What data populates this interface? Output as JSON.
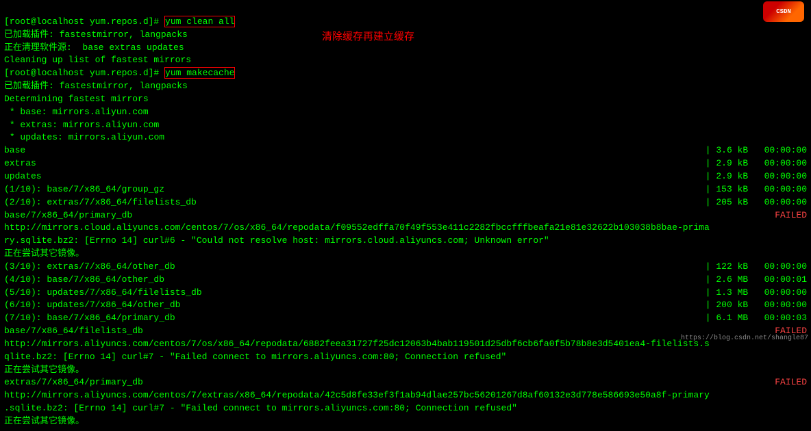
{
  "terminal": {
    "lines": [
      {
        "type": "cmd",
        "prompt": "[root@localhost yum.repos.d]# ",
        "cmd": "yum clean all",
        "highlight": true
      },
      {
        "type": "normal",
        "text": "已加载插件: fastestmirror, langpacks"
      },
      {
        "type": "normal",
        "text": "正在清理软件源:  base extras updates"
      },
      {
        "type": "normal",
        "text": "Cleaning up list of fastest mirrors"
      },
      {
        "type": "cmd",
        "prompt": "[root@localhost yum.repos.d]# ",
        "cmd": "yum makecache",
        "highlight": true
      },
      {
        "type": "normal",
        "text": "已加载插件: fastestmirror, langpacks"
      },
      {
        "type": "normal",
        "text": "Determining fastest mirrors"
      },
      {
        "type": "normal",
        "text": " * base: mirrors.aliyun.com"
      },
      {
        "type": "normal",
        "text": " * extras: mirrors.aliyun.com"
      },
      {
        "type": "normal",
        "text": " * updates: mirrors.aliyun.com"
      },
      {
        "type": "rightcol",
        "left": "base",
        "right": "| 3.6 kB   00:00:00"
      },
      {
        "type": "rightcol",
        "left": "extras",
        "right": "| 2.9 kB   00:00:00"
      },
      {
        "type": "rightcol",
        "left": "updates",
        "right": "| 2.9 kB   00:00:00"
      },
      {
        "type": "rightcol",
        "left": "(1/10): base/7/x86_64/group_gz",
        "right": "| 153 kB   00:00:00"
      },
      {
        "type": "rightcol",
        "left": "(2/10): extras/7/x86_64/filelists_db",
        "right": "| 205 kB   00:00:00"
      },
      {
        "type": "failed",
        "left": "base/7/x86_64/primary_db",
        "right": "FAILED"
      },
      {
        "type": "normal",
        "text": "http://mirrors.cloud.aliyuncs.com/centos/7/os/x86_64/repodata/f09552edffa70f49f553e411c2282fbccfffbeafa21e81e32622b103038b8bae-prima"
      },
      {
        "type": "normal",
        "text": "ry.sqlite.bz2: [Errno 14] curl#6 - \"Could not resolve host: mirrors.cloud.aliyuncs.com; Unknown error\""
      },
      {
        "type": "normal",
        "text": "正在尝试其它镜像。"
      },
      {
        "type": "rightcol",
        "left": "(3/10): extras/7/x86_64/other_db",
        "right": "| 122 kB   00:00:00"
      },
      {
        "type": "rightcol",
        "left": "(4/10): base/7/x86_64/other_db",
        "right": "| 2.6 MB   00:00:01"
      },
      {
        "type": "rightcol",
        "left": "(5/10): updates/7/x86_64/filelists_db",
        "right": "| 1.3 MB   00:00:00"
      },
      {
        "type": "rightcol",
        "left": "(6/10): updates/7/x86_64/other_db",
        "right": "| 200 kB   00:00:00"
      },
      {
        "type": "rightcol",
        "left": "(7/10): base/7/x86_64/primary_db",
        "right": "| 6.1 MB   00:00:03"
      },
      {
        "type": "failed",
        "left": "base/7/x86_64/filelists_db",
        "right": "FAILED"
      },
      {
        "type": "normal",
        "text": "http://mirrors.aliyuncs.com/centos/7/os/x86_64/repodata/6882feea31727f25dc12063b4bab119501d25dbf6cb6fa0f5b78b8e3d5401ea4-filelists.s"
      },
      {
        "type": "normal",
        "text": "qlite.bz2: [Errno 14] curl#7 - \"Failed connect to mirrors.aliyuncs.com:80; Connection refused\""
      },
      {
        "type": "normal",
        "text": "正在尝试其它镜像。"
      },
      {
        "type": "failed",
        "left": "extras/7/x86_64/primary_db",
        "right": "FAILED"
      },
      {
        "type": "normal",
        "text": "http://mirrors.aliyuncs.com/centos/7/extras/x86_64/repodata/42c5d8fe33ef3f1ab94dlae257bc56201267d8af60132e3d778e586693e50a8f-primary"
      },
      {
        "type": "normal",
        "text": ".sqlite.bz2: [Errno 14] curl#7 - \"Failed connect to mirrors.aliyuncs.com:80; Connection refused\""
      },
      {
        "type": "normal",
        "text": "正在尝试其它镜像。"
      }
    ],
    "annotation": "清除缓存再建立缓存",
    "watermark": "https://blog.csdn.net/shangle87"
  }
}
